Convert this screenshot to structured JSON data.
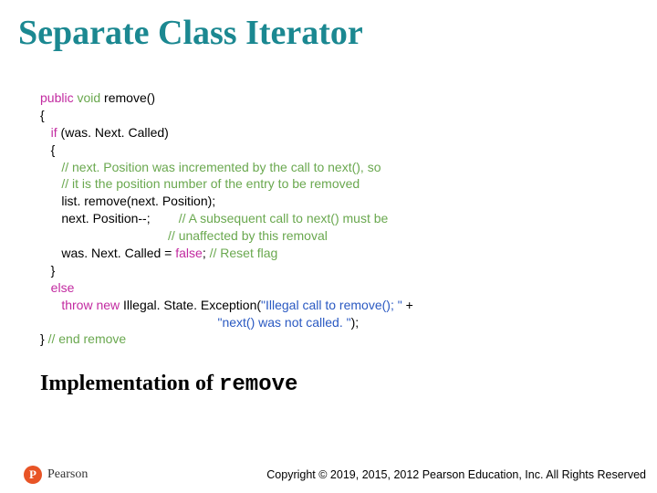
{
  "title": "Separate Class Iterator",
  "code": {
    "l1_public": "public",
    "l1_void": "void",
    "l1_rest": " remove()",
    "l2": "{",
    "l3_if": "if",
    "l3_rest": " (was. Next. Called)",
    "l4": "   {",
    "l5_cm": "      // next. Position was incremented by the call to next(), so",
    "l6_cm": "      // it is the position number of the entry to be removed",
    "l7": "      list. remove(next. Position);",
    "l8a": "      next. Position--;        ",
    "l8_cm": "// A subsequent call to next() must be",
    "l9_cm": "                                    // unaffected by this removal",
    "l10a": "      was. Next. Called = ",
    "l10_false": "false",
    "l10b": "; ",
    "l10_cm": "// Reset flag",
    "l11": "   }",
    "l12_else": "else",
    "l13_throw": "throw",
    "l13_new": " new",
    "l13a": " Illegal. State. Exception(",
    "l13_str": "\"Illegal call to remove(); \"",
    "l13b": " +",
    "l14_str": "                                                  \"next() was not called. \"",
    "l14b": ");",
    "l15a": "} ",
    "l15_cm": "// end remove"
  },
  "caption_prefix": "Implementation of ",
  "caption_mono": "remove",
  "logo_letter": "P",
  "logo_text": "Pearson",
  "copyright": "Copyright © 2019, 2015, 2012 Pearson Education, Inc. All Rights Reserved"
}
